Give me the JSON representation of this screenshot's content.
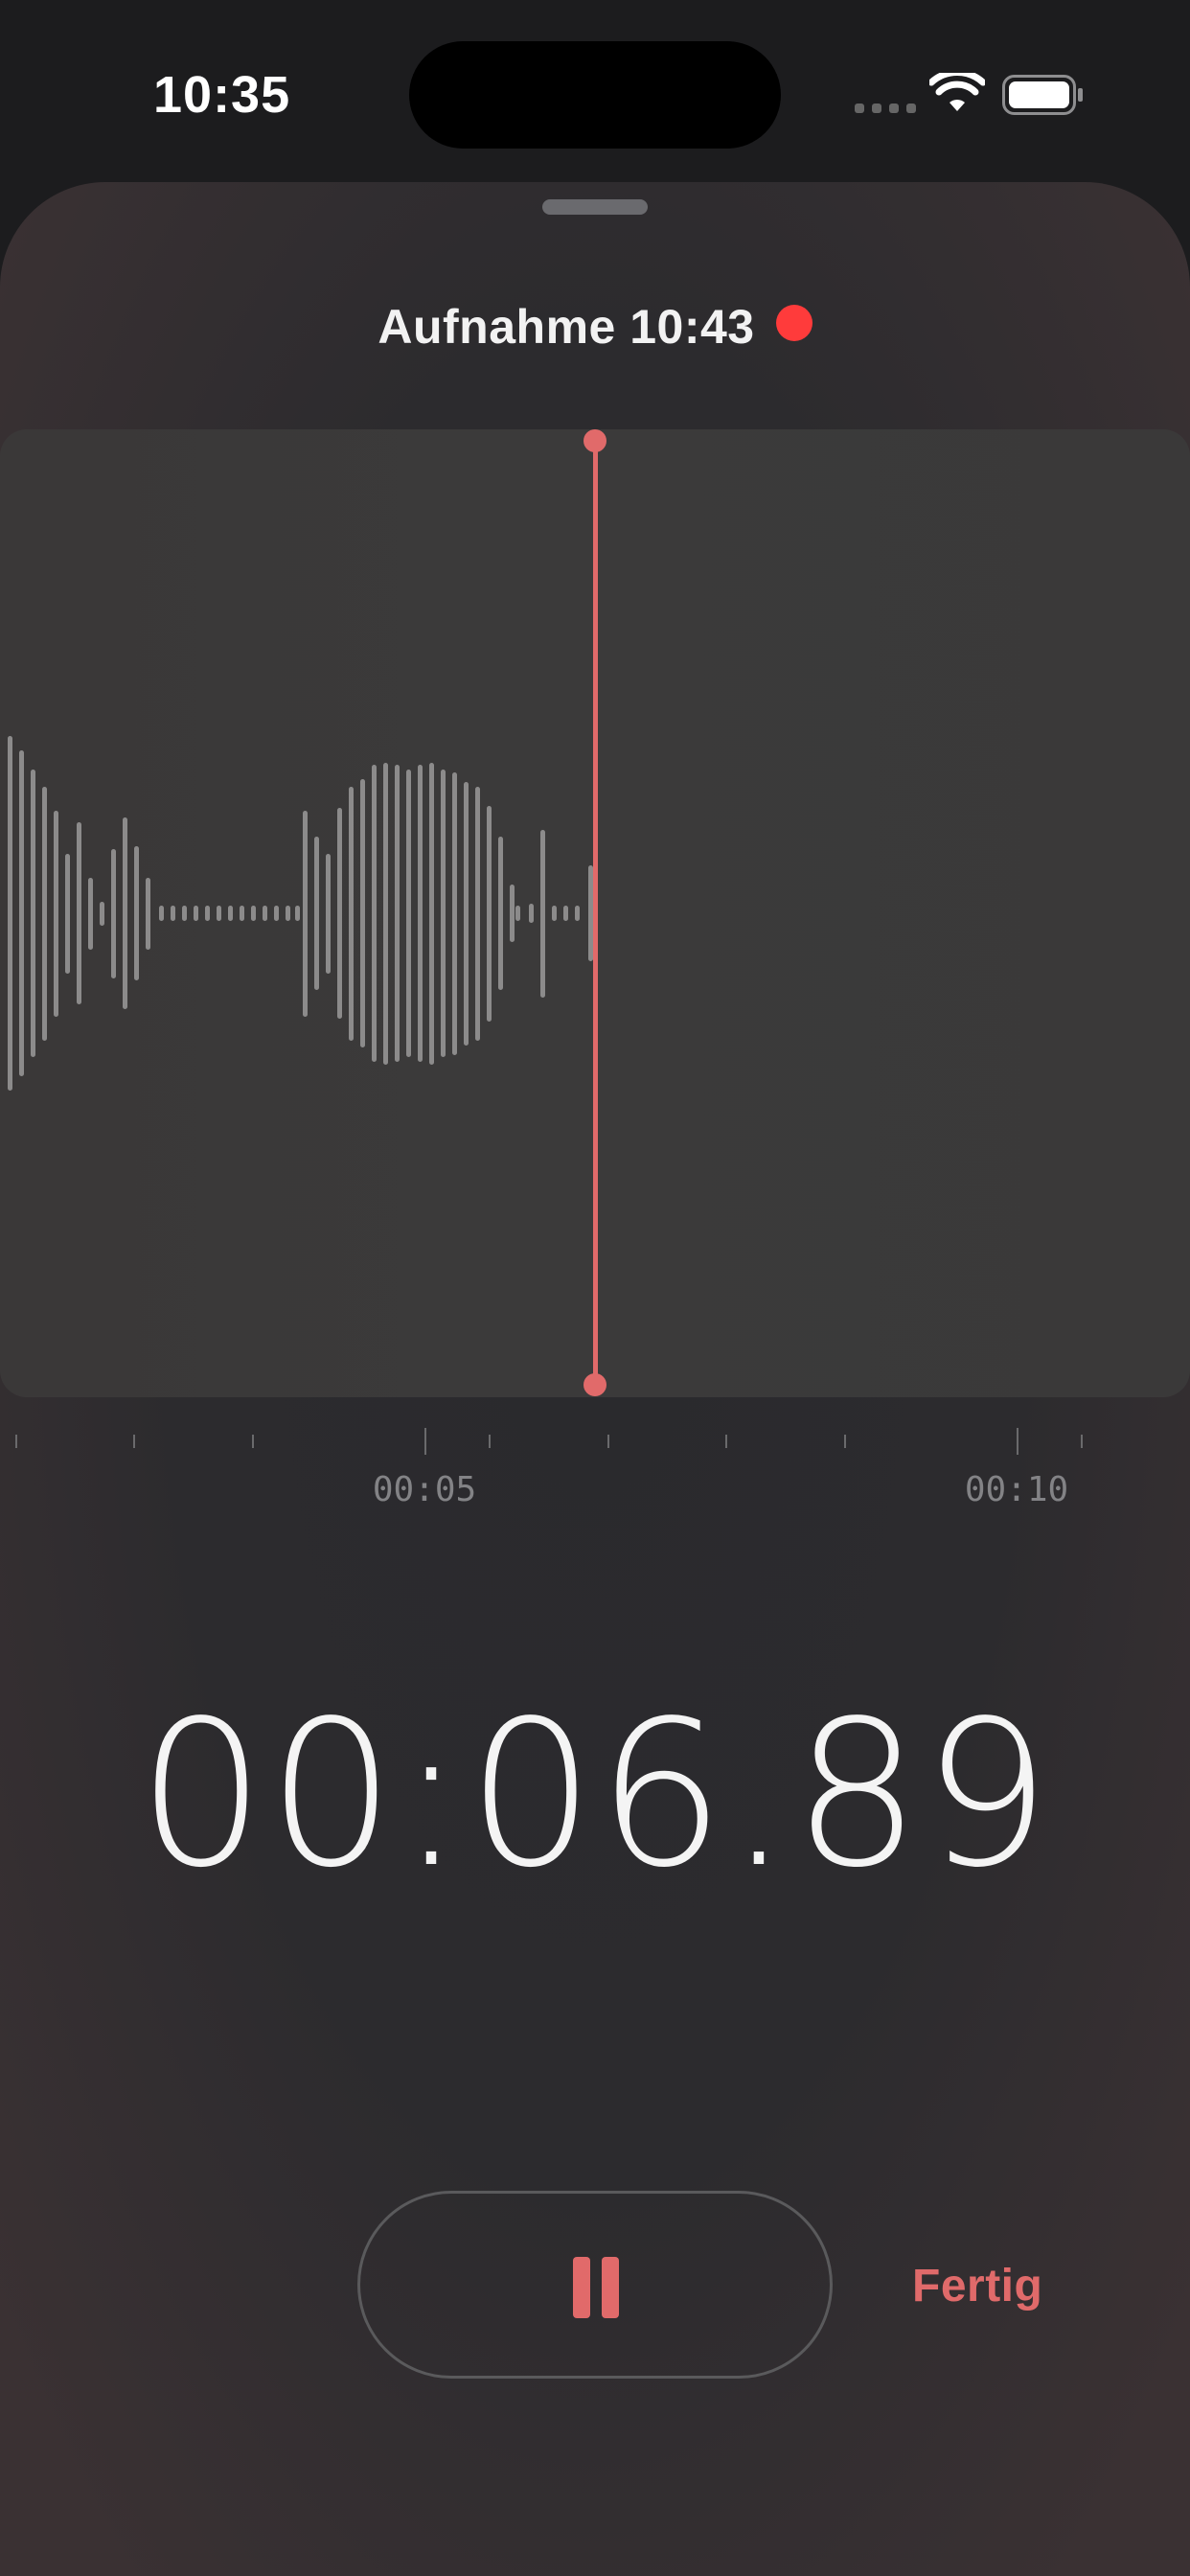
{
  "status_bar": {
    "time": "10:35",
    "wifi": "wifi-icon",
    "battery": "battery-full-icon"
  },
  "sheet": {
    "title": "Aufnahme 10:43",
    "recording_indicator_color": "#ff3b3b"
  },
  "waveform": {
    "accent_color": "#e16a6a",
    "timeline_labels": [
      "00:05",
      "00:10"
    ]
  },
  "timer": {
    "value": "00:06.89"
  },
  "controls": {
    "pause_icon": "pause-icon",
    "done_label": "Fertig"
  }
}
